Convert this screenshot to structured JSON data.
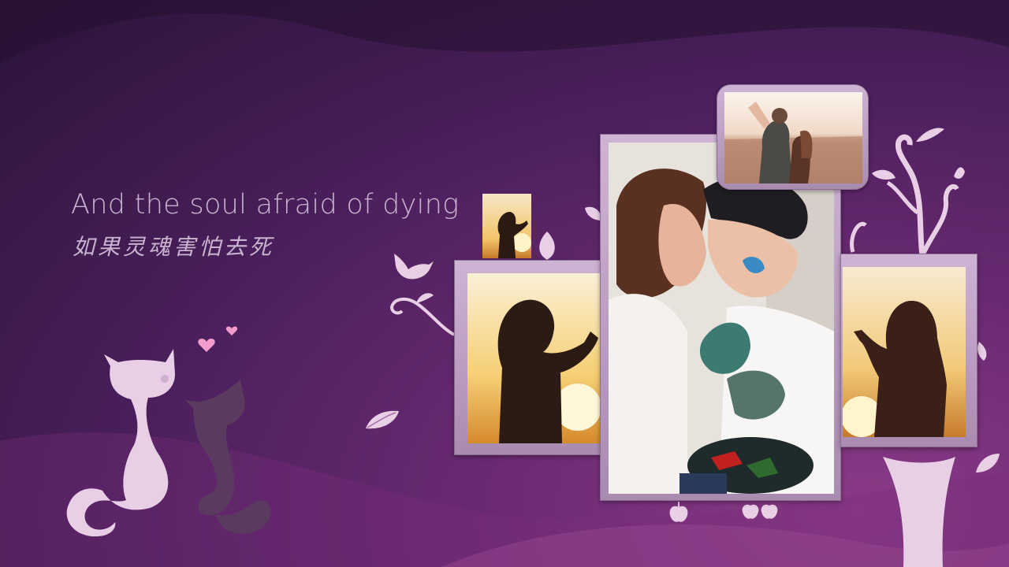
{
  "lyrics": {
    "english": "And the soul afraid of dying",
    "chinese": "如果灵魂害怕去死"
  },
  "colors": {
    "background_dark": "#2a1438",
    "background_light": "#8a3a86",
    "text": "#c9b4cf",
    "frame": "#cfb3d4",
    "silhouette_light": "#e9cfe6",
    "silhouette_dark": "#5a3a5e",
    "heart": "#f29ccc"
  },
  "decorations": {
    "icons": [
      "cat-light-icon",
      "cat-dark-icon",
      "heart-icon",
      "bird-icon",
      "leaf-icon",
      "tree-icon",
      "apple-icon"
    ]
  },
  "photos": [
    {
      "name": "photo-boy-silhouette-small",
      "subject": "boy silhouette at sunset"
    },
    {
      "name": "photo-boy-heart-hands",
      "subject": "boy making heart shape at sunset"
    },
    {
      "name": "photo-couple-painted-hands",
      "subject": "couple touching foreheads"
    },
    {
      "name": "photo-couple-field",
      "subject": "couple embracing in field"
    },
    {
      "name": "photo-girl-heart-hands",
      "subject": "girl making heart shape at sunset"
    }
  ]
}
